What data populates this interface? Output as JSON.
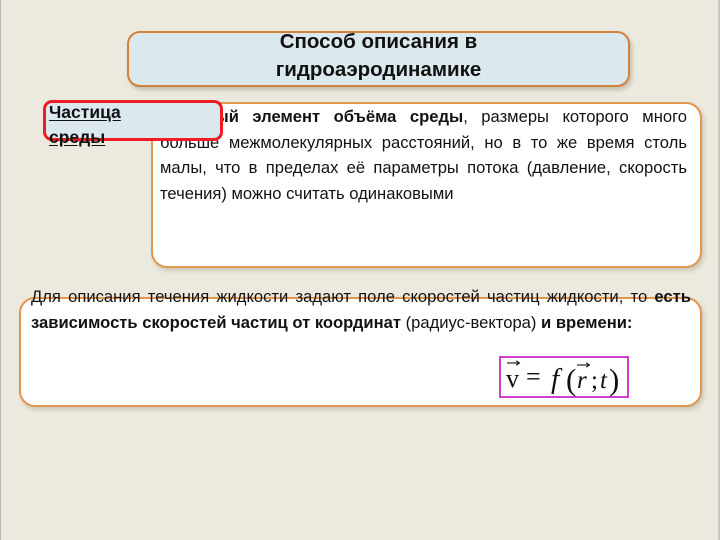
{
  "slide": {
    "background_color": "#eceade",
    "title": {
      "line1": "Способ описания в",
      "line2": "гидроаэродинамике",
      "box_fill": "#dbe9ef",
      "box_border": "#d2813a"
    },
    "particle_callout": {
      "line1": "Частица",
      "line2": "среды",
      "box_fill": "#dbe9ef",
      "box_border": "#ee1c24"
    },
    "definition": {
      "bold_lead": "– малый элемент объёма среды",
      "rest": ", размеры которого много больше межмолекулярных расстояний, но в то же время столь малы, что в пределах её параметры потока (давление, скорость течения) можно считать одинаковыми",
      "box_fill": "#ffffff",
      "box_border": "#e2974f"
    },
    "statement": {
      "part1": "Для описания течения жидкости задают поле скоростей частиц жидкости, то ",
      "part2_bold": "есть зависимость скоростей частиц от координат",
      "part3": " (радиус-вектора) ",
      "part4_bold": "и времени:",
      "box_fill": "#ffffff",
      "box_border": "#e2974f"
    },
    "formula": {
      "text": "v = f(r; t)",
      "lhs": "v",
      "equals": "=",
      "func": "f",
      "open": "(",
      "arg1": "r",
      "sep": ";",
      "arg2": "t",
      "close": ")",
      "border_color": "#d13fd1"
    }
  }
}
